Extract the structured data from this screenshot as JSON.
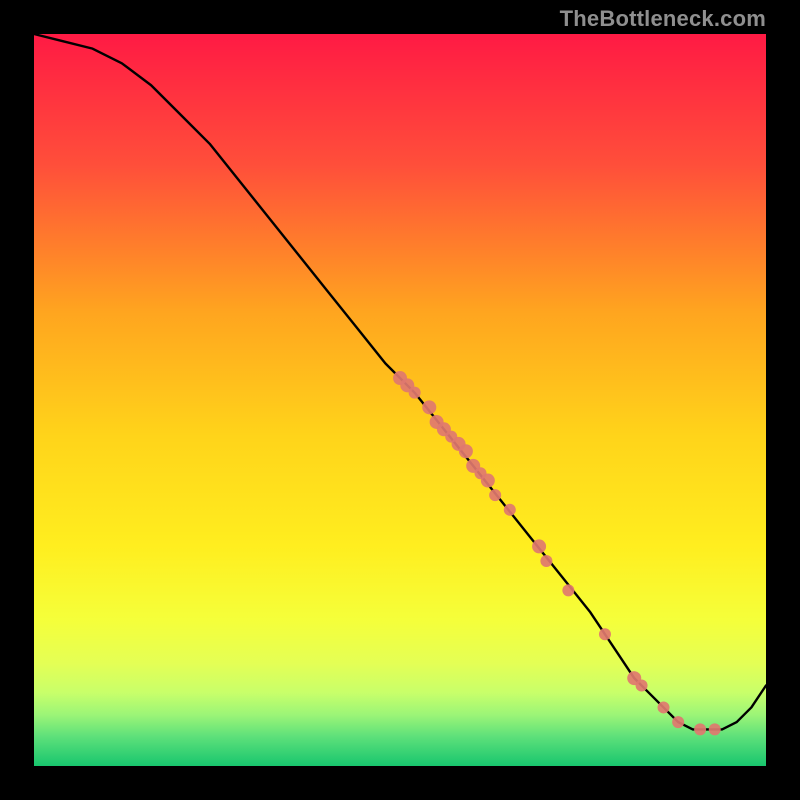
{
  "watermark": "TheBottleneck.com",
  "chart_data": {
    "type": "line",
    "title": "",
    "xlabel": "",
    "ylabel": "",
    "xlim": [
      0,
      100
    ],
    "ylim": [
      0,
      100
    ],
    "grid": false,
    "legend": false,
    "gradient_colors": {
      "top": "#ff1a44",
      "mid_upper": "#ffb000",
      "mid": "#ffe000",
      "mid_lower": "#f5ff3a",
      "low": "#d4ff66",
      "bottom": "#18c66e"
    },
    "curve": {
      "name": "bottleneck-curve",
      "x": [
        0,
        4,
        8,
        12,
        16,
        20,
        24,
        28,
        32,
        36,
        40,
        44,
        48,
        52,
        56,
        60,
        64,
        68,
        72,
        76,
        80,
        82,
        84,
        86,
        88,
        90,
        92,
        94,
        96,
        98,
        100
      ],
      "y": [
        100,
        99,
        98,
        96,
        93,
        89,
        85,
        80,
        75,
        70,
        65,
        60,
        55,
        51,
        46,
        41,
        36,
        31,
        26,
        21,
        15,
        12,
        10,
        8,
        6,
        5,
        5,
        5,
        6,
        8,
        11
      ]
    },
    "markers": {
      "name": "data-markers",
      "color": "#e0786f",
      "points": [
        {
          "x": 50,
          "y": 53,
          "r": 7
        },
        {
          "x": 51,
          "y": 52,
          "r": 7
        },
        {
          "x": 52,
          "y": 51,
          "r": 6
        },
        {
          "x": 54,
          "y": 49,
          "r": 7
        },
        {
          "x": 55,
          "y": 47,
          "r": 7
        },
        {
          "x": 56,
          "y": 46,
          "r": 7
        },
        {
          "x": 57,
          "y": 45,
          "r": 6
        },
        {
          "x": 58,
          "y": 44,
          "r": 7
        },
        {
          "x": 59,
          "y": 43,
          "r": 7
        },
        {
          "x": 60,
          "y": 41,
          "r": 7
        },
        {
          "x": 61,
          "y": 40,
          "r": 6
        },
        {
          "x": 62,
          "y": 39,
          "r": 7
        },
        {
          "x": 63,
          "y": 37,
          "r": 6
        },
        {
          "x": 65,
          "y": 35,
          "r": 6
        },
        {
          "x": 69,
          "y": 30,
          "r": 7
        },
        {
          "x": 70,
          "y": 28,
          "r": 6
        },
        {
          "x": 73,
          "y": 24,
          "r": 6
        },
        {
          "x": 78,
          "y": 18,
          "r": 6
        },
        {
          "x": 82,
          "y": 12,
          "r": 7
        },
        {
          "x": 83,
          "y": 11,
          "r": 6
        },
        {
          "x": 86,
          "y": 8,
          "r": 6
        },
        {
          "x": 88,
          "y": 6,
          "r": 6
        },
        {
          "x": 91,
          "y": 5,
          "r": 6
        },
        {
          "x": 93,
          "y": 5,
          "r": 6
        }
      ]
    }
  }
}
